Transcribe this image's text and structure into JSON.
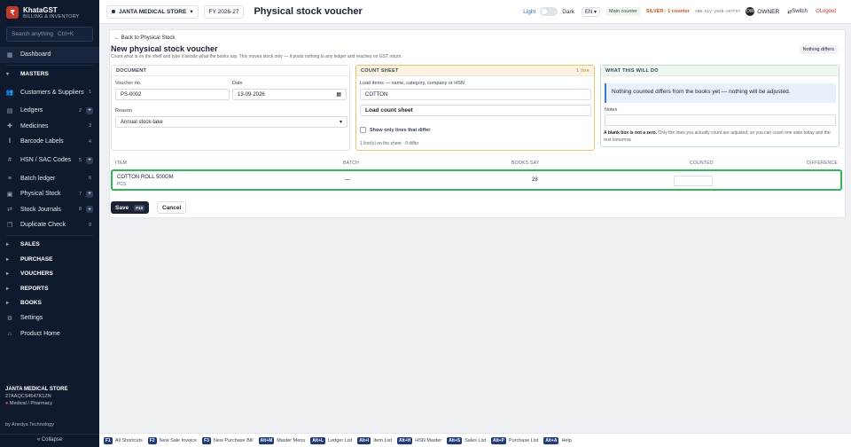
{
  "brand": {
    "name": "KhataGST",
    "sub": "BILLING & INVENTORY"
  },
  "search": {
    "placeholder": "Search anything",
    "shortcut": "Ctrl+K"
  },
  "sidebar": {
    "dashboard": "Dashboard",
    "masters": "MASTERS",
    "items": [
      {
        "label": "Customers & Suppliers",
        "count": "1"
      },
      {
        "label": "Ledgers",
        "count": "2"
      },
      {
        "label": "Medicines",
        "count": "3"
      },
      {
        "label": "Barcode Labels",
        "count": "4"
      },
      {
        "label": "HSN / SAC Codes",
        "count": "5"
      },
      {
        "label": "Batch ledger",
        "count": "6"
      },
      {
        "label": "Physical Stock",
        "count": "7"
      },
      {
        "label": "Stock Journals",
        "count": "8"
      },
      {
        "label": "Duplicate Check",
        "count": "9"
      }
    ],
    "sections": [
      "SALES",
      "PURCHASE",
      "VOUCHERS",
      "REPORTS",
      "BOOKS"
    ],
    "settings": "Settings",
    "product_home": "Product Home",
    "collapse": "« Collapse"
  },
  "shop": {
    "name": "JANTA MEDICAL STORE",
    "gstin": "27AAQCS4547K1ZN",
    "type": "Medical / Pharmacy",
    "by": "by Anedya Technology"
  },
  "topbar": {
    "store": "JANTA MEDICAL STORE",
    "fy": "FY 2026-27",
    "title": "Physical stock voucher",
    "light": "Light",
    "dark": "Dark",
    "lang": "EN",
    "main_counter": "Main counter",
    "silver": "SILVER · 1 counter",
    "code": "ANB-SLV-2026-A07F07",
    "avatar": "OW",
    "owner": "OWNER",
    "switch": "Switch",
    "logout": "Logout"
  },
  "page": {
    "back": "← Back to Physical Stock",
    "title": "New physical stock voucher",
    "subtitle": "Count what is on the shelf and type it beside what the books say. This moves stock only — it posts nothing to any ledger and reaches no GST return.",
    "badge": "Nothing differs"
  },
  "document": {
    "header": "DOCUMENT",
    "voucher_label": "Voucher no.",
    "voucher_value": "PS-0002",
    "date_label": "Date",
    "date_value": "13-09-2026",
    "reason_label": "Reason",
    "reason_value": "Annual stock-take"
  },
  "count_sheet": {
    "header": "COUNT SHEET",
    "lines": "1 line",
    "load_label": "Load items — name, category, company or HSN",
    "load_value": "COTTON",
    "load_button": "Load count sheet",
    "show_differ": "Show only lines that differ",
    "summary": "1 line(s) on the sheet · 0 differ"
  },
  "will_do": {
    "header": "WHAT THIS WILL DO",
    "info": "Nothing counted differs from the books yet — nothing will be adjusted.",
    "notes_label": "Notes",
    "note_bold": "A blank box is not a zero.",
    "note_text": "Only the lines you actually count are adjusted, so you can count one aisle today and the rest tomorrow."
  },
  "table": {
    "headers": {
      "item": "ITEM",
      "batch": "BATCH",
      "books": "BOOKS SAY",
      "counted": "COUNTED",
      "difference": "DIFFERENCE"
    },
    "rows": [
      {
        "name": "COTTON ROLL 500GM",
        "unit": "PCS",
        "batch": "—",
        "books": "28",
        "counted": ""
      }
    ]
  },
  "actions": {
    "save": "Save",
    "save_key": "F10",
    "cancel": "Cancel"
  },
  "footer": [
    {
      "key": "F1",
      "label": "All Shortcuts"
    },
    {
      "key": "F2",
      "label": "New Sale Invoice"
    },
    {
      "key": "F3",
      "label": "New Purchase Bill"
    },
    {
      "key": "Alt+M",
      "label": "Master Menu"
    },
    {
      "key": "Alt+L",
      "label": "Ledger List"
    },
    {
      "key": "Alt+I",
      "label": "Item List"
    },
    {
      "key": "Alt+H",
      "label": "HSN Master"
    },
    {
      "key": "Alt+S",
      "label": "Sales List"
    },
    {
      "key": "Alt+P",
      "label": "Purchase List"
    },
    {
      "key": "Alt+A",
      "label": "Help"
    }
  ]
}
